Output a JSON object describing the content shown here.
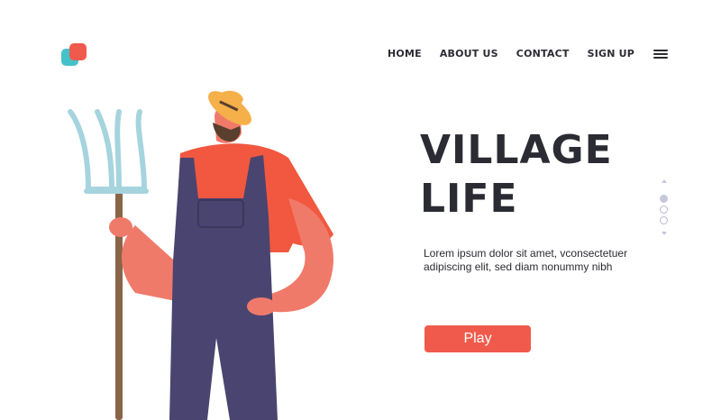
{
  "header": {
    "logo_icon": "two-overlapping-rounded-squares-logo",
    "nav": [
      {
        "label": "HOME"
      },
      {
        "label": "ABOUT US"
      },
      {
        "label": "CONTACT"
      },
      {
        "label": "SIGN UP"
      }
    ],
    "menu_icon": "hamburger-menu-icon"
  },
  "hero": {
    "title_line1": "VILLAGE",
    "title_line2": "LIFE",
    "description": "Lorem ipsum dolor sit amet, vconsectetuer adipiscing elit, sed diam nonummy nibh",
    "play_label": "Play"
  },
  "pager": {
    "pages": 3,
    "active_index": 0
  },
  "colors": {
    "accent": "#f05a4c",
    "logo_teal": "#44c2c9",
    "text": "#2b2b33",
    "overalls": "#4a4470",
    "shirt": "#f1583f",
    "skin": "#f07a6a",
    "hat": "#f5b04a",
    "pitchfork": "#a6d4de",
    "handle": "#8a6448"
  }
}
